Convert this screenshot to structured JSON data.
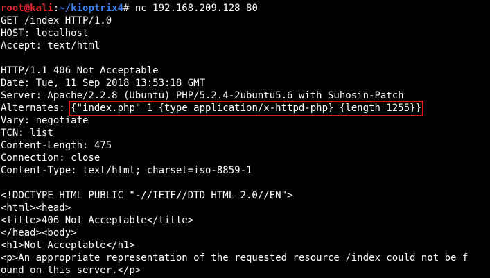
{
  "prompt": {
    "user_host": "root@kali",
    "separator": ":",
    "path": "~/kioptrix4",
    "symbol": "#",
    "command": " nc 192.168.209.128 80"
  },
  "request": [
    "GET /index HTTP/1.0",
    "HOST: localhost",
    "Accept: text/html",
    ""
  ],
  "response_headers": {
    "status": "HTTP/1.1 406 Not Acceptable",
    "date": "Date: Tue, 11 Sep 2018 13:53:18 GMT",
    "server": "Server: Apache/2.2.8 (Ubuntu) PHP/5.2.4-2ubuntu5.6 with Suhosin-Patch",
    "alternates_label": "Alternates: ",
    "alternates_value": "{\"index.php\" 1 {type application/x-httpd-php} {length 1255}}",
    "vary": "Vary: negotiate",
    "tcn": "TCN: list",
    "content_length": "Content-Length: 475",
    "connection": "Connection: close",
    "content_type": "Content-Type: text/html; charset=iso-8859-1"
  },
  "body_lines": [
    "",
    "<!DOCTYPE HTML PUBLIC \"-//IETF//DTD HTML 2.0//EN\">",
    "<html><head>",
    "<title>406 Not Acceptable</title>",
    "</head><body>",
    "<h1>Not Acceptable</h1>",
    "<p>An appropriate representation of the requested resource /index could not be f",
    "ound on this server.</p>"
  ],
  "colors": {
    "background": "#000000",
    "text": "#ffffff",
    "prompt_user": "#e2262b",
    "prompt_path": "#3b82f6",
    "highlight": "#e01717"
  }
}
